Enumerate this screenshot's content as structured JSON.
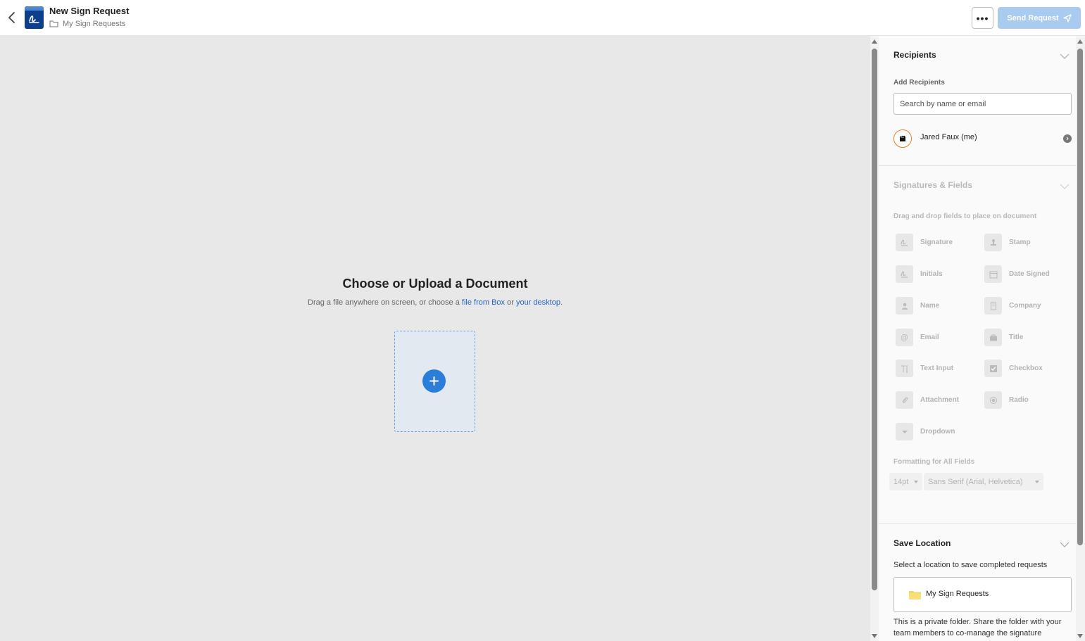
{
  "header": {
    "title": "New Sign Request",
    "breadcrumb": "My Sign Requests",
    "more_label": "•••",
    "send_label": "Send Request"
  },
  "canvas": {
    "title": "Choose or Upload a Document",
    "subtitle_prefix": "Drag a file anywhere on screen, or choose a ",
    "link_box": "file from Box",
    "subtitle_mid": " or ",
    "link_desktop": "your desktop",
    "subtitle_suffix": "."
  },
  "recipients": {
    "heading": "Recipients",
    "add_label": "Add Recipients",
    "search_placeholder": "Search by name or email",
    "items": [
      {
        "name": "Jared Faux (me)"
      }
    ]
  },
  "fields_section": {
    "heading": "Signatures & Fields",
    "hint": "Drag and drop fields to place on document",
    "fields": [
      {
        "label": "Signature",
        "icon": "signature-icon"
      },
      {
        "label": "Stamp",
        "icon": "stamp-icon"
      },
      {
        "label": "Initials",
        "icon": "initials-icon"
      },
      {
        "label": "Date Signed",
        "icon": "calendar-icon"
      },
      {
        "label": "Name",
        "icon": "person-icon"
      },
      {
        "label": "Company",
        "icon": "building-icon"
      },
      {
        "label": "Email",
        "icon": "at-icon"
      },
      {
        "label": "Title",
        "icon": "briefcase-icon"
      },
      {
        "label": "Text Input",
        "icon": "text-icon"
      },
      {
        "label": "Checkbox",
        "icon": "checkbox-icon"
      },
      {
        "label": "Attachment",
        "icon": "paperclip-icon"
      },
      {
        "label": "Radio",
        "icon": "radio-icon"
      },
      {
        "label": "Dropdown",
        "icon": "dropdown-icon"
      }
    ],
    "formatting_label": "Formatting for All Fields",
    "font_size": "14pt",
    "font_family": "Sans Serif (Arial, Helvetica)"
  },
  "save_location": {
    "heading": "Save Location",
    "description": "Select a location to save completed requests",
    "folder_name": "My Sign Requests",
    "note": "This is a private folder. Share the folder with your team members to co-manage the signature"
  },
  "colors": {
    "accent": "#2b7ddb",
    "send_disabled": "#a9cbef",
    "app_icon": "#0e3f8c",
    "avatar_ring": "#f07b22",
    "folder": "#f5d565"
  }
}
